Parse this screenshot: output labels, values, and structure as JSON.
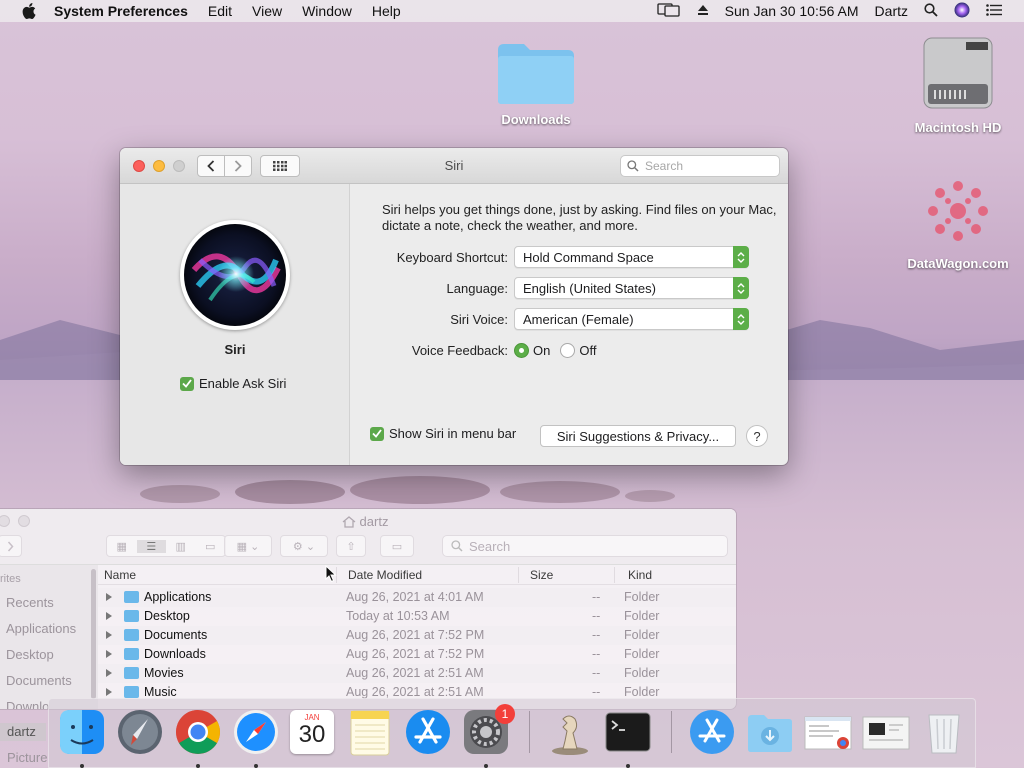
{
  "menubar": {
    "app_name": "System Preferences",
    "items": [
      "Edit",
      "View",
      "Window",
      "Help"
    ],
    "datetime": "Sun Jan 30  10:56 AM",
    "user": "Dartz"
  },
  "desktop": {
    "icons": [
      {
        "label": "Downloads",
        "icon": "folder-icon"
      },
      {
        "label": "Macintosh HD",
        "icon": "hard-drive-icon"
      },
      {
        "label": "DataWagon.com",
        "icon": "image-file-icon"
      }
    ]
  },
  "siri_window": {
    "title": "Siri",
    "search_placeholder": "Search",
    "app_label": "Siri",
    "enable_label": "Enable Ask Siri",
    "enable_checked": true,
    "description": "Siri helps you get things done, just by asking. Find files on your Mac, dictate a note, check the weather, and more.",
    "settings": [
      {
        "label": "Keyboard Shortcut:",
        "value": "Hold Command Space"
      },
      {
        "label": "Language:",
        "value": "English (United States)"
      },
      {
        "label": "Siri Voice:",
        "value": "American (Female)"
      }
    ],
    "voice_feedback": {
      "label": "Voice Feedback:",
      "options": [
        "On",
        "Off"
      ],
      "selected": "On"
    },
    "show_in_menubar_label": "Show Siri in menu bar",
    "show_in_menubar_checked": true,
    "privacy_button": "Siri Suggestions & Privacy...",
    "help_button": "?",
    "accent_color": "#5cae48"
  },
  "finder": {
    "title": "dartz",
    "search_placeholder": "Search",
    "sidebar": {
      "heading": "rites",
      "items": [
        "Recents",
        "Applications",
        "Desktop",
        "Documents",
        "Downlo",
        "dartz",
        "Picture"
      ]
    },
    "columns": [
      "Name",
      "Date Modified",
      "Size",
      "Kind"
    ],
    "rows": [
      {
        "name": "Applications",
        "date": "Aug 26, 2021 at 4:01 AM",
        "size": "--",
        "kind": "Folder"
      },
      {
        "name": "Desktop",
        "date": "Today at 10:53 AM",
        "size": "--",
        "kind": "Folder"
      },
      {
        "name": "Documents",
        "date": "Aug 26, 2021 at 7:52 PM",
        "size": "--",
        "kind": "Folder"
      },
      {
        "name": "Downloads",
        "date": "Aug 26, 2021 at 7:52 PM",
        "size": "--",
        "kind": "Folder"
      },
      {
        "name": "Movies",
        "date": "Aug 26, 2021 at 2:51 AM",
        "size": "--",
        "kind": "Folder"
      },
      {
        "name": "Music",
        "date": "Aug 26, 2021 at 2:51 AM",
        "size": "--",
        "kind": "Folder"
      }
    ]
  },
  "dock": {
    "calendar_month": "JAN",
    "calendar_day": "30",
    "prefs_badge": "1",
    "apps": [
      "finder-icon",
      "launchpad-icon",
      "chrome-icon",
      "safari-icon",
      "calendar-icon",
      "notes-icon",
      "app-store-icon",
      "system-preferences-icon",
      "chess-icon",
      "terminal-icon",
      "applications-folder-icon",
      "downloads-stack-icon",
      "document-preview-icon",
      "window-preview-icon",
      "trash-icon"
    ]
  }
}
